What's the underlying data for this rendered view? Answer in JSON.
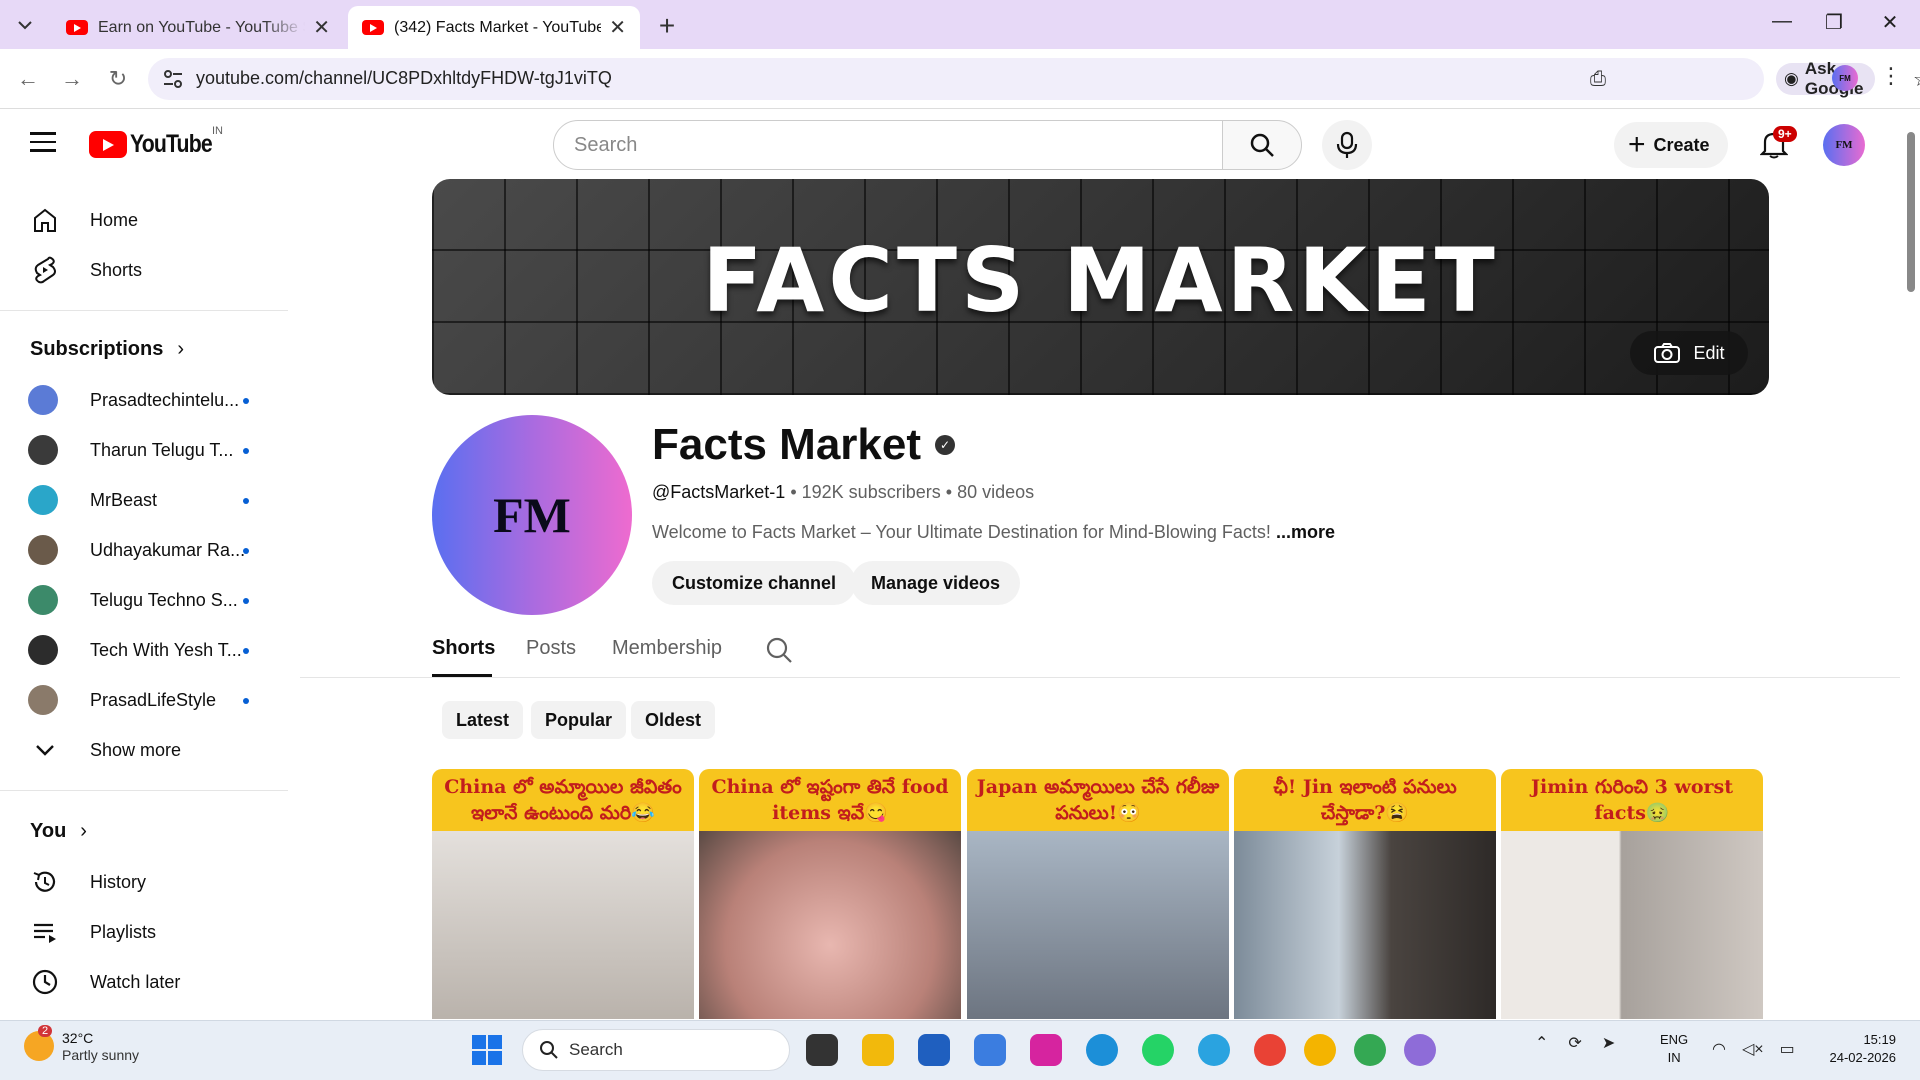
{
  "browser": {
    "tabs": [
      {
        "title": "Earn on YouTube - YouTube Studio",
        "active": false
      },
      {
        "title": "(342) Facts Market - YouTube",
        "active": true
      }
    ],
    "url": "youtube.com/channel/UC8PDxhltdyFHDW-tgJ1viTQ",
    "ask_google_label": "Ask Google",
    "profile_initials": "FM"
  },
  "masthead": {
    "logo_text": "YouTube",
    "region": "IN",
    "search_placeholder": "Search",
    "create_label": "Create",
    "notification_count": "9+",
    "avatar_initials": "FM"
  },
  "sidebar": {
    "top_items": [
      {
        "label": "Home",
        "icon": "home-icon"
      },
      {
        "label": "Shorts",
        "icon": "shorts-icon"
      }
    ],
    "subscriptions_heading": "Subscriptions",
    "subscriptions": [
      {
        "label": "Prasadtechintelu...",
        "color": "#5b7bd6"
      },
      {
        "label": "Tharun Telugu T...",
        "color": "#3a3a3a"
      },
      {
        "label": "MrBeast",
        "color": "#2aa6c9"
      },
      {
        "label": "Udhayakumar Ra...",
        "color": "#6a5a4a"
      },
      {
        "label": "Telugu Techno S...",
        "color": "#3c8a6a"
      },
      {
        "label": "Tech With Yesh T...",
        "color": "#2c2c2c"
      },
      {
        "label": "PrasadLifeStyle",
        "color": "#8a7a6a"
      }
    ],
    "show_more_label": "Show more",
    "you_heading": "You",
    "you_items": [
      {
        "label": "History",
        "icon": "history-icon"
      },
      {
        "label": "Playlists",
        "icon": "playlists-icon"
      },
      {
        "label": "Watch later",
        "icon": "watch-later-icon"
      }
    ]
  },
  "banner": {
    "title": "FACTS MARKET",
    "edit_label": "Edit"
  },
  "channel": {
    "avatar_text": "FM",
    "name": "Facts Market",
    "handle": "@FactsMarket-1",
    "subscribers": "192K subscribers",
    "videos": "80 videos",
    "description": "Welcome to Facts Market – Your Ultimate Destination for Mind-Blowing Facts!",
    "more_label": "...more",
    "customize_label": "Customize channel",
    "manage_label": "Manage videos",
    "separator": "•"
  },
  "tabs": [
    "Shorts",
    "Posts",
    "Membership"
  ],
  "chips": [
    "Latest",
    "Popular",
    "Oldest"
  ],
  "shorts": [
    {
      "caption": "China లో అమ్మాయిల జీవితం ఇలానే ఉంటుంది మరి😂",
      "tone": "#d9d4cf"
    },
    {
      "caption": "China లో ఇష్టంగా తినే food items ఇవే😋",
      "tone": "#d9a7a0"
    },
    {
      "caption": "Japan అమ్మాయిలు చేసే గలీజు పనులు!😳",
      "tone": "#9aa7b4"
    },
    {
      "caption": "ఛీ! Jin ఇలాంటి పనులు చేస్తాడా?😫",
      "tone": "#6e7a86"
    },
    {
      "caption": "Jimin గురించి 3 worst facts🤢",
      "tone": "#cfc9c4"
    }
  ],
  "taskbar": {
    "weather_temp": "32°C",
    "weather_condition": "Partly sunny",
    "weather_badge": "2",
    "search_label": "Search",
    "lang_line1": "ENG",
    "lang_line2": "IN",
    "time": "15:19",
    "date": "24-02-2026",
    "apps": [
      {
        "name": "task-view",
        "color": "#333333"
      },
      {
        "name": "file-explorer",
        "color": "#f2b90c"
      },
      {
        "name": "microsoft-store",
        "color": "#1f5fbf"
      },
      {
        "name": "notepad",
        "color": "#3b7de0"
      },
      {
        "name": "instagram",
        "color": "#d6249f"
      },
      {
        "name": "edge",
        "color": "#1c8fd8"
      },
      {
        "name": "whatsapp",
        "color": "#25d366"
      },
      {
        "name": "telegram",
        "color": "#2aa3e0"
      },
      {
        "name": "chrome",
        "color": "#e94235"
      },
      {
        "name": "chrome-2",
        "color": "#f4b400"
      },
      {
        "name": "chrome-3",
        "color": "#34a853"
      },
      {
        "name": "chrome-4",
        "color": "#8e6cd8"
      }
    ]
  }
}
